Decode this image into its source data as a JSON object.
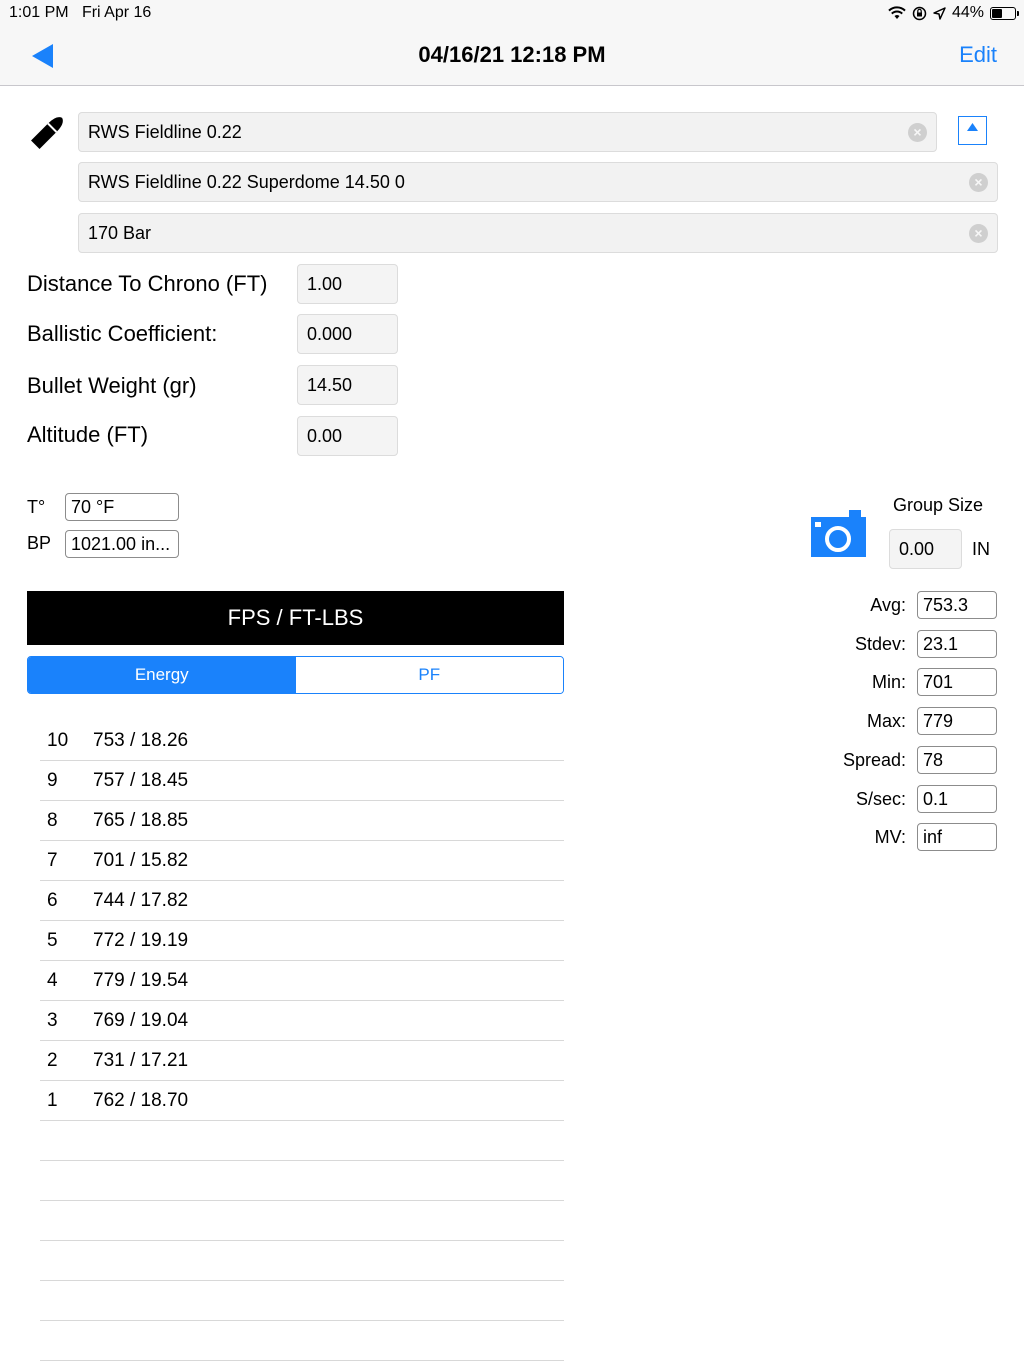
{
  "status_bar": {
    "time": "1:01 PM",
    "date": "Fri Apr 16",
    "battery": "44%"
  },
  "nav": {
    "title": "04/16/21 12:18 PM",
    "edit_label": "Edit"
  },
  "fields": {
    "pellet": "RWS Fieldline 0.22",
    "load": "RWS Fieldline 0.22 Superdome 14.50 0",
    "pressure": "170 Bar"
  },
  "params": [
    {
      "label": "Distance To Chrono (FT)",
      "value": "1.00"
    },
    {
      "label": "Ballistic Coefficient:",
      "value": "0.000"
    },
    {
      "label": "Bullet Weight (gr)",
      "value": "14.50"
    },
    {
      "label": "Altitude (FT)",
      "value": "0.00"
    }
  ],
  "env": {
    "temp_label": "T°",
    "temp_value": "70 °F",
    "bp_label": "BP",
    "bp_value": "1021.00 in..."
  },
  "group": {
    "label": "Group Size",
    "value": "0.00",
    "unit": "IN"
  },
  "results_header": "FPS / FT-LBS",
  "segments": {
    "energy": "Energy",
    "pf": "PF"
  },
  "shots": [
    {
      "n": "10",
      "v": "753 / 18.26"
    },
    {
      "n": "9",
      "v": "757 / 18.45"
    },
    {
      "n": "8",
      "v": "765 / 18.85"
    },
    {
      "n": "7",
      "v": "701 / 15.82"
    },
    {
      "n": "6",
      "v": "744 / 17.82"
    },
    {
      "n": "5",
      "v": "772 / 19.19"
    },
    {
      "n": "4",
      "v": "779 / 19.54"
    },
    {
      "n": "3",
      "v": "769 / 19.04"
    },
    {
      "n": "2",
      "v": "731 / 17.21"
    },
    {
      "n": "1",
      "v": "762 / 18.70"
    }
  ],
  "stats": [
    {
      "label": "Avg:",
      "value": "753.3"
    },
    {
      "label": "Stdev:",
      "value": "23.1"
    },
    {
      "label": "Min:",
      "value": "701"
    },
    {
      "label": "Max:",
      "value": "779"
    },
    {
      "label": "Spread:",
      "value": "78"
    },
    {
      "label": "S/sec:",
      "value": "0.1"
    },
    {
      "label": "MV:",
      "value": "inf"
    }
  ],
  "colors": {
    "accent": "#1a82fb",
    "header_bg": "#000000"
  }
}
